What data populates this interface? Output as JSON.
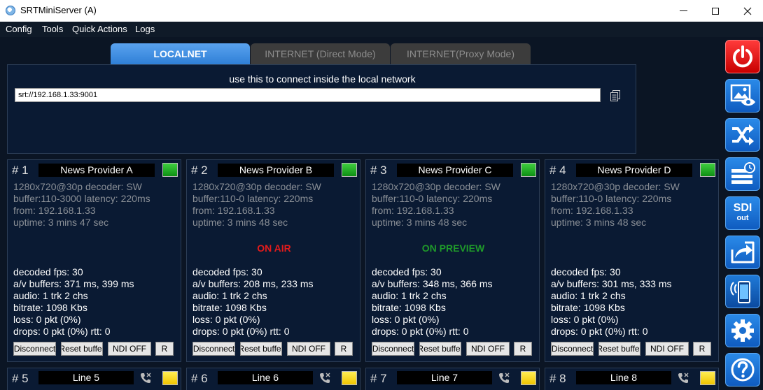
{
  "window": {
    "title": "SRTMiniServer (A)"
  },
  "menu": [
    "Config",
    "Tools",
    "Quick Actions",
    "Logs"
  ],
  "tabs": [
    "LOCALNET",
    "INTERNET (Direct Mode)",
    "INTERNET(Proxy Mode)"
  ],
  "connect": {
    "label": "use this to connect inside the local network",
    "url": "srt://192.168.1.33:9001"
  },
  "cards": [
    {
      "num": "# 1",
      "name": "News Provider A",
      "led": "green",
      "info": [
        "1280x720@30p decoder: SW",
        "buffer:110-3000 latency: 220ms",
        "from: 192.168.1.33",
        "uptime:  3 mins 47 sec"
      ],
      "status": "",
      "status_color": "",
      "stats": [
        "decoded fps: 30",
        "a/v buffers: 371 ms, 399 ms",
        "audio: 1 trk 2 chs",
        "bitrate: 1098 Kbs",
        "loss: 0 pkt (0%)",
        "drops: 0 pkt (0%) rtt: 0"
      ]
    },
    {
      "num": "# 2",
      "name": "News Provider B",
      "led": "green",
      "info": [
        "1280x720@30p decoder: SW",
        "buffer:110-0 latency: 220ms",
        "from: 192.168.1.33",
        "uptime:  3 mins 48 sec"
      ],
      "status": "ON AIR",
      "status_color": "#e41b1b",
      "stats": [
        "decoded fps: 30",
        "a/v buffers: 208 ms, 233 ms",
        "audio: 1 trk 2 chs",
        "bitrate: 1098 Kbs",
        "loss: 0 pkt (0%)",
        "drops: 0 pkt (0%) rtt: 0"
      ]
    },
    {
      "num": "# 3",
      "name": "News Provider C",
      "led": "green",
      "info": [
        "1280x720@30p decoder: SW",
        "buffer:110-0 latency: 220ms",
        "from: 192.168.1.33",
        "uptime:  3 mins 48 sec"
      ],
      "status": "ON PREVIEW",
      "status_color": "#1f9a2a",
      "stats": [
        "decoded fps: 30",
        "a/v buffers: 348 ms, 366 ms",
        "audio: 1 trk 2 chs",
        "bitrate: 1098 Kbs",
        "loss: 0 pkt (0%)",
        "drops: 0 pkt (0%) rtt: 0"
      ]
    },
    {
      "num": "# 4",
      "name": "News Provider D",
      "led": "green",
      "info": [
        "1280x720@30p decoder: SW",
        "buffer:110-0 latency: 220ms",
        "from: 192.168.1.33",
        "uptime:  3 mins 48 sec"
      ],
      "status": "",
      "status_color": "",
      "stats": [
        "decoded fps: 30",
        "a/v buffers: 301 ms, 333 ms",
        "audio: 1 trk 2 chs",
        "bitrate: 1098 Kbs",
        "loss: 0 pkt (0%)",
        "drops: 0 pkt (0%) rtt: 0"
      ]
    }
  ],
  "card_buttons": {
    "disconnect": "Disconnect",
    "reset": "Reset buffer",
    "ndi": "NDI OFF",
    "r": "R"
  },
  "lines": [
    {
      "num": "# 5",
      "name": "Line 5"
    },
    {
      "num": "# 6",
      "name": "Line 6"
    },
    {
      "num": "# 7",
      "name": "Line 7"
    },
    {
      "num": "# 8",
      "name": "Line 8"
    }
  ],
  "toolbar": {
    "icons": [
      "power-icon",
      "preview-icon",
      "shuffle-icon",
      "schedule-icon",
      "sdi-out-icon",
      "share-icon",
      "mobile-icon",
      "settings-icon",
      "help-icon"
    ],
    "sdi_label": "SDI",
    "sdi_sub": "out"
  },
  "colors": {
    "accent": "#2f7fd6",
    "background": "#0b1524",
    "panel": "#0a1a33",
    "led_green": "#1fae26",
    "led_yellow": "#ffd600",
    "power": "#e00000"
  }
}
